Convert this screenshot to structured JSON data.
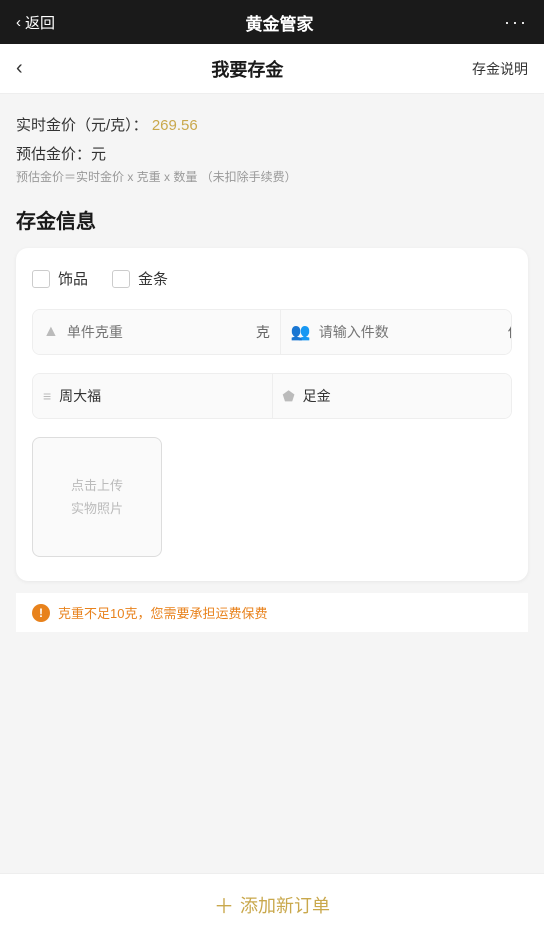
{
  "topBar": {
    "back_label": "返回",
    "title": "黄金管家",
    "more_icon": "···"
  },
  "secondaryHeader": {
    "back_icon": "‹",
    "title": "我要存金",
    "action_label": "存金说明"
  },
  "priceSection": {
    "real_time_label": "实时金价（元/克）：",
    "real_time_value": "269.56",
    "estimate_label": "预估金价：元",
    "estimate_note": "预估金价＝实时金价 x 克重 x 数量  （未扣除手续费）"
  },
  "depositInfo": {
    "section_title": "存金信息",
    "checkbox1_label": "饰品",
    "checkbox2_label": "金条",
    "weight_placeholder": "单件克重",
    "weight_unit": "克",
    "count_placeholder": "请输入件数",
    "count_unit": "件",
    "brand_icon": "≡",
    "brand_value": "周大福",
    "material_icon": "⬟",
    "material_value": "足金",
    "upload_line1": "点击上传",
    "upload_line2": "实物照片"
  },
  "warning": {
    "text": "克重不足10克，您需要承担运费保费"
  },
  "footer": {
    "add_label": "添加新订单",
    "add_plus": "＋"
  }
}
